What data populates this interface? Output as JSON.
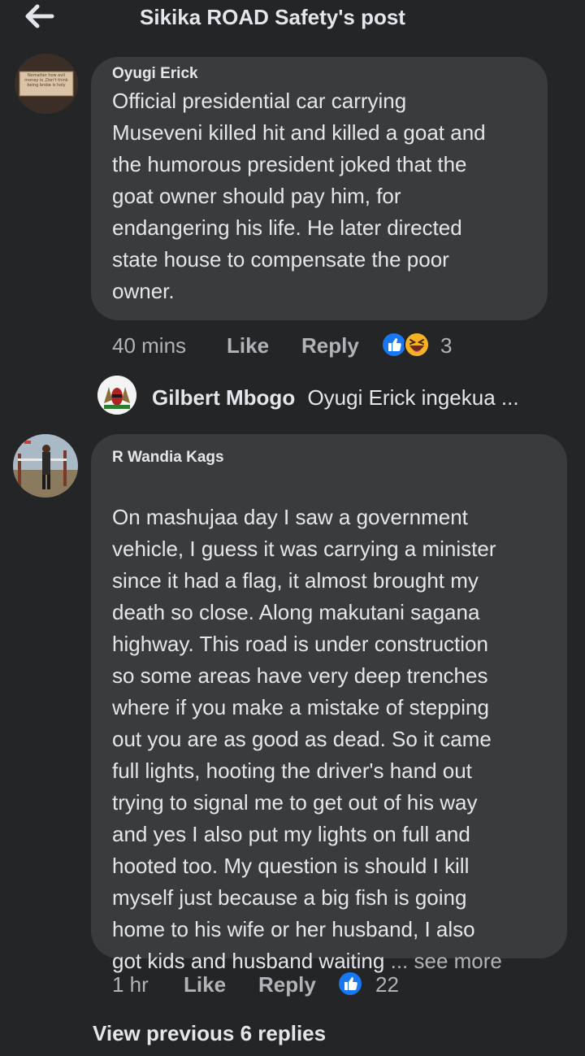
{
  "header": {
    "title": "Sikika ROAD Safety's post"
  },
  "comments": [
    {
      "author": "Oyugi Erick",
      "avatar_text": "Nomatter how evil money is ,Don't think being broke is holy",
      "text": "Official presidential car  carrying\nMuseveni killed hit and killed a goat and\nthe humorous president joked that the\ngoat owner should pay him, for\nendangering his life. He later directed\nstate house to compensate the poor\nowner.",
      "time": "40 mins",
      "like_label": "Like",
      "reply_label": "Reply",
      "reaction_count": "3",
      "reactions": [
        "like-icon",
        "laugh-icon"
      ],
      "reply_preview": {
        "author": "Gilbert Mbogo",
        "text": "Oyugi Erick ingekua ..."
      }
    },
    {
      "author": "R Wandia Kags",
      "text": "On mashujaa day I saw a government\nvehicle, I guess it was carrying a minister\nsince it had a flag, it almost brought my\ndeath so close. Along makutani sagana\nhighway. This road is under construction\nso some areas have very deep trenches\nwhere if you make a mistake of stepping\nout you are as good as dead. So it came\nfull lights, hooting the driver's hand out\ntrying to signal me to get out of his way\nand yes I also put my lights on full and\nhooted too. My question is should I kill\nmyself just because a big fish is going\nhome to his wife or her husband, I also\ngot kids and husband waiting",
      "see_more": "... see more",
      "time": "1 hr",
      "like_label": "Like",
      "reply_label": "Reply",
      "reaction_count": "22",
      "reactions": [
        "like-icon"
      ]
    }
  ],
  "view_previous": "View previous 6 replies",
  "colors": {
    "background": "#242526",
    "bubble": "#3a3b3c",
    "text": "#e4e6eb",
    "secondary_text": "#b0b3b8",
    "like_blue": "#1877f2",
    "laugh_yellow": "#f7b125"
  }
}
